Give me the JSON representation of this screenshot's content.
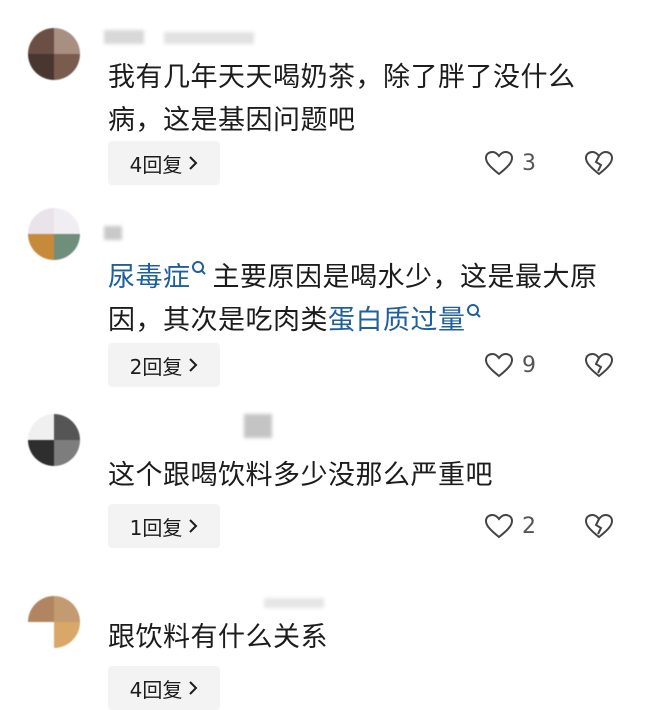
{
  "comments": [
    {
      "text": "我有几年天天喝奶茶，除了胖了没什么病，这是基因问题吧",
      "reply_label": "4回复",
      "like_count": "3"
    },
    {
      "link1": "尿毒症",
      "text1": "主要原因是喝水少，这是最大原因，其次是吃肉类",
      "link2": "蛋白质过量",
      "reply_label": "2回复",
      "like_count": "9"
    },
    {
      "text": "这个跟喝饮料多少没那么严重吧",
      "reply_label": "1回复",
      "like_count": "2"
    },
    {
      "text": "跟饮料有什么关系",
      "reply_label": "4回复"
    }
  ],
  "icons": {
    "search": "search-icon",
    "like": "heart-icon",
    "dislike": "broken-heart-icon",
    "chevron": "chevron-right-icon"
  },
  "colors": {
    "link": "#1f5f9e",
    "reply_bg": "#f3f3f3",
    "text": "#1c1c1c"
  }
}
